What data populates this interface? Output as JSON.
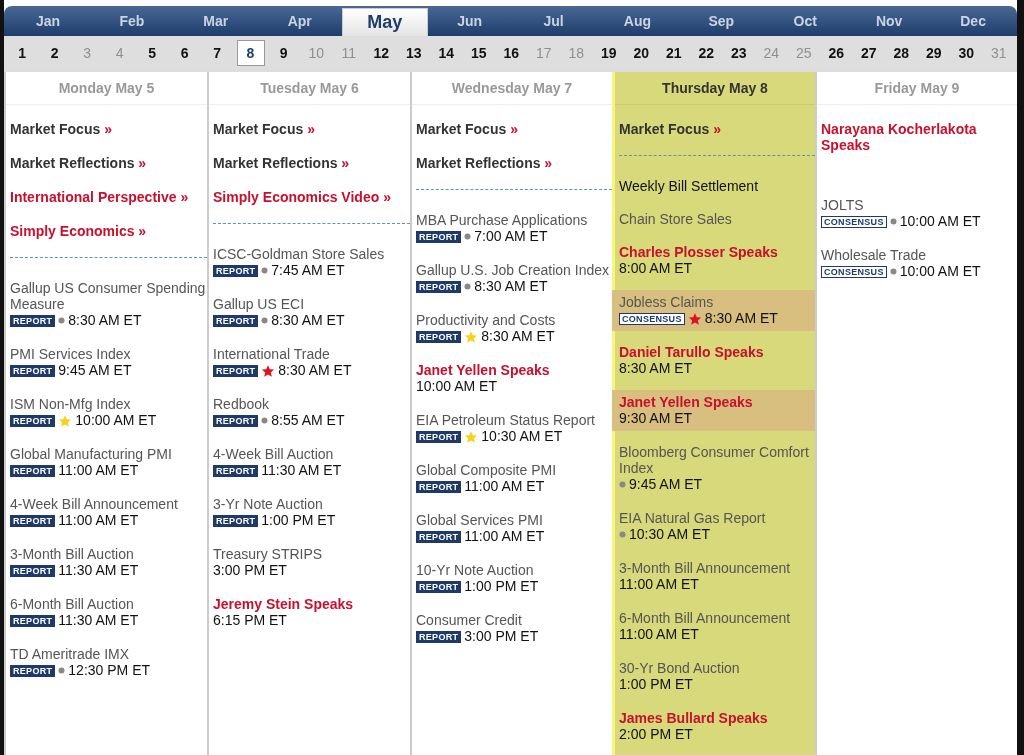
{
  "months": [
    {
      "label": "Jan",
      "selected": false
    },
    {
      "label": "Feb",
      "selected": false
    },
    {
      "label": "Mar",
      "selected": false
    },
    {
      "label": "Apr",
      "selected": false
    },
    {
      "label": "May",
      "selected": true
    },
    {
      "label": "Jun",
      "selected": false
    },
    {
      "label": "Jul",
      "selected": false
    },
    {
      "label": "Aug",
      "selected": false
    },
    {
      "label": "Sep",
      "selected": false
    },
    {
      "label": "Oct",
      "selected": false
    },
    {
      "label": "Nov",
      "selected": false
    },
    {
      "label": "Dec",
      "selected": false
    }
  ],
  "days": [
    {
      "label": "1",
      "selected": false,
      "weekend": false
    },
    {
      "label": "2",
      "selected": false,
      "weekend": false
    },
    {
      "label": "3",
      "selected": false,
      "weekend": true
    },
    {
      "label": "4",
      "selected": false,
      "weekend": true
    },
    {
      "label": "5",
      "selected": false,
      "weekend": false
    },
    {
      "label": "6",
      "selected": false,
      "weekend": false
    },
    {
      "label": "7",
      "selected": false,
      "weekend": false
    },
    {
      "label": "8",
      "selected": true,
      "weekend": false
    },
    {
      "label": "9",
      "selected": false,
      "weekend": false
    },
    {
      "label": "10",
      "selected": false,
      "weekend": true
    },
    {
      "label": "11",
      "selected": false,
      "weekend": true
    },
    {
      "label": "12",
      "selected": false,
      "weekend": false
    },
    {
      "label": "13",
      "selected": false,
      "weekend": false
    },
    {
      "label": "14",
      "selected": false,
      "weekend": false
    },
    {
      "label": "15",
      "selected": false,
      "weekend": false
    },
    {
      "label": "16",
      "selected": false,
      "weekend": false
    },
    {
      "label": "17",
      "selected": false,
      "weekend": true
    },
    {
      "label": "18",
      "selected": false,
      "weekend": true
    },
    {
      "label": "19",
      "selected": false,
      "weekend": false
    },
    {
      "label": "20",
      "selected": false,
      "weekend": false
    },
    {
      "label": "21",
      "selected": false,
      "weekend": false
    },
    {
      "label": "22",
      "selected": false,
      "weekend": false
    },
    {
      "label": "23",
      "selected": false,
      "weekend": false
    },
    {
      "label": "24",
      "selected": false,
      "weekend": true
    },
    {
      "label": "25",
      "selected": false,
      "weekend": true
    },
    {
      "label": "26",
      "selected": false,
      "weekend": false
    },
    {
      "label": "27",
      "selected": false,
      "weekend": false
    },
    {
      "label": "28",
      "selected": false,
      "weekend": false
    },
    {
      "label": "29",
      "selected": false,
      "weekend": false
    },
    {
      "label": "30",
      "selected": false,
      "weekend": false
    },
    {
      "label": "31",
      "selected": false,
      "weekend": true
    }
  ],
  "columns": [
    {
      "title": "Monday May 5",
      "today": false,
      "links": [
        {
          "label": "Market Focus",
          "arrow": "»",
          "kind": "feature"
        },
        {
          "label": "Market Reflections",
          "arrow": "»",
          "kind": "feature"
        },
        {
          "label": "International Perspective",
          "arrow": "»",
          "kind": "highlight"
        },
        {
          "label": "Simply Economics",
          "arrow": "»",
          "kind": "highlight"
        }
      ],
      "events": [
        {
          "name": "Gallup US Consumer Spending Measure",
          "kind": "release",
          "badge": "REPORT",
          "bullet": true,
          "starred": false,
          "time": "8:30 AM ET",
          "highlighted": false
        },
        {
          "name": "PMI Services Index",
          "kind": "release",
          "badge": "REPORT",
          "bullet": false,
          "starred": false,
          "time": "9:45 AM ET",
          "highlighted": false
        },
        {
          "name": "ISM Non-Mfg Index",
          "kind": "release",
          "badge": "REPORT",
          "bullet": false,
          "starred": true,
          "color": "#f7d21c",
          "time": "10:00 AM ET",
          "highlighted": false
        },
        {
          "name": "Global Manufacturing PMI",
          "kind": "release",
          "badge": "REPORT",
          "bullet": false,
          "starred": false,
          "time": "11:00 AM ET",
          "highlighted": false
        },
        {
          "name": "4-Week Bill Announcement",
          "kind": "release",
          "badge": "REPORT",
          "bullet": false,
          "starred": false,
          "time": "11:00 AM ET",
          "highlighted": false
        },
        {
          "name": "3-Month Bill Auction",
          "kind": "release",
          "badge": "REPORT",
          "bullet": false,
          "starred": false,
          "time": "11:30 AM ET",
          "highlighted": false
        },
        {
          "name": "6-Month Bill Auction",
          "kind": "release",
          "badge": "REPORT",
          "bullet": false,
          "starred": false,
          "time": "11:30 AM ET",
          "highlighted": false
        },
        {
          "name": "TD Ameritrade IMX",
          "kind": "release",
          "badge": "REPORT",
          "bullet": true,
          "starred": false,
          "time": "12:30 PM ET",
          "highlighted": false
        }
      ]
    },
    {
      "title": "Tuesday May 6",
      "today": false,
      "links": [
        {
          "label": "Market Focus",
          "arrow": "»",
          "kind": "feature"
        },
        {
          "label": "Market Reflections",
          "arrow": "»",
          "kind": "feature"
        },
        {
          "label": "Simply Economics Video",
          "arrow": "»",
          "kind": "highlight"
        }
      ],
      "events": [
        {
          "name": "ICSC-Goldman Store Sales",
          "kind": "release",
          "badge": "REPORT",
          "bullet": true,
          "starred": false,
          "time": "7:45 AM ET",
          "highlighted": false
        },
        {
          "name": "Gallup US ECI",
          "kind": "release",
          "badge": "REPORT",
          "bullet": true,
          "starred": false,
          "time": "8:30 AM ET",
          "highlighted": false
        },
        {
          "name": "International Trade",
          "kind": "release",
          "badge": "REPORT",
          "bullet": false,
          "starred": true,
          "color": "#e01020",
          "time": "8:30 AM ET",
          "highlighted": false
        },
        {
          "name": "Redbook",
          "kind": "release",
          "badge": "REPORT",
          "bullet": true,
          "starred": false,
          "time": "8:55 AM ET",
          "highlighted": false
        },
        {
          "name": "4-Week Bill Auction",
          "kind": "release",
          "badge": "REPORT",
          "bullet": false,
          "starred": false,
          "time": "11:30 AM ET",
          "highlighted": false
        },
        {
          "name": "3-Yr Note Auction",
          "kind": "release",
          "badge": "REPORT",
          "bullet": false,
          "starred": false,
          "time": "1:00 PM ET",
          "highlighted": false
        },
        {
          "name": "Treasury STRIPS",
          "kind": "release",
          "bullet": false,
          "starred": false,
          "time": "3:00 PM ET",
          "highlighted": false
        },
        {
          "name": "Jeremy Stein Speaks",
          "kind": "speech",
          "bullet": false,
          "starred": false,
          "time": "6:15 PM ET",
          "highlighted": false
        }
      ]
    },
    {
      "title": "Wednesday May 7",
      "today": false,
      "links": [
        {
          "label": "Market Focus",
          "arrow": "»",
          "kind": "feature"
        },
        {
          "label": "Market Reflections",
          "arrow": "»",
          "kind": "feature"
        }
      ],
      "events": [
        {
          "name": "MBA Purchase Applications",
          "kind": "release",
          "badge": "REPORT",
          "bullet": true,
          "starred": false,
          "time": "7:00 AM ET",
          "highlighted": false
        },
        {
          "name": "Gallup U.S. Job Creation Index",
          "kind": "release",
          "badge": "REPORT",
          "bullet": true,
          "starred": false,
          "time": "8:30 AM ET",
          "highlighted": false
        },
        {
          "name": "Productivity and Costs",
          "kind": "release",
          "badge": "REPORT",
          "bullet": false,
          "starred": true,
          "color": "#f7d21c",
          "time": "8:30 AM ET",
          "highlighted": false
        },
        {
          "name": "Janet Yellen Speaks",
          "kind": "speech",
          "bullet": false,
          "starred": false,
          "time": "10:00 AM ET",
          "highlighted": false
        },
        {
          "name": "EIA Petroleum Status Report",
          "kind": "release",
          "badge": "REPORT",
          "bullet": false,
          "starred": true,
          "color": "#f7d21c",
          "time": "10:30 AM ET",
          "highlighted": false
        },
        {
          "name": "Global Composite PMI",
          "kind": "release",
          "badge": "REPORT",
          "bullet": false,
          "starred": false,
          "time": "11:00 AM ET",
          "highlighted": false
        },
        {
          "name": "Global Services PMI",
          "kind": "release",
          "badge": "REPORT",
          "bullet": false,
          "starred": false,
          "time": "11:00 AM ET",
          "highlighted": false
        },
        {
          "name": "10-Yr Note Auction",
          "kind": "release",
          "badge": "REPORT",
          "bullet": false,
          "starred": false,
          "time": "1:00 PM ET",
          "highlighted": false
        },
        {
          "name": "Consumer Credit",
          "kind": "release",
          "badge": "REPORT",
          "bullet": false,
          "starred": false,
          "time": "3:00 PM ET",
          "highlighted": false
        }
      ]
    },
    {
      "title": "Thursday May 8",
      "today": true,
      "links": [
        {
          "label": "Market Focus",
          "arrow": "»",
          "kind": "feature"
        }
      ],
      "events": [
        {
          "name": "Weekly Bill Settlement",
          "kind": "notice",
          "bullet": false,
          "starred": false,
          "highlighted": false
        },
        {
          "name": "Chain Store Sales",
          "kind": "release",
          "bullet": false,
          "starred": false,
          "highlighted": false
        },
        {
          "name": "Charles Plosser Speaks",
          "kind": "speech",
          "bullet": false,
          "starred": false,
          "time": "8:00 AM ET",
          "highlighted": false
        },
        {
          "name": "Jobless Claims",
          "kind": "release",
          "badge": "CONSENSUS",
          "bullet": false,
          "starred": true,
          "color": "#e01020",
          "time": "8:30 AM ET",
          "highlighted": true
        },
        {
          "name": "Daniel Tarullo Speaks",
          "kind": "speech",
          "bullet": false,
          "starred": false,
          "time": "8:30 AM ET",
          "highlighted": false
        },
        {
          "name": "Janet Yellen Speaks",
          "kind": "speech",
          "bullet": false,
          "starred": false,
          "time": "9:30 AM ET",
          "highlighted": true
        },
        {
          "name": "Bloomberg Consumer Comfort Index",
          "kind": "release",
          "bullet": true,
          "starred": false,
          "time": "9:45 AM ET",
          "highlighted": false
        },
        {
          "name": "EIA Natural Gas Report",
          "kind": "release",
          "bullet": true,
          "starred": false,
          "time": "10:30 AM ET",
          "highlighted": false
        },
        {
          "name": "3-Month Bill Announcement",
          "kind": "release",
          "bullet": false,
          "starred": false,
          "time": "11:00 AM ET",
          "highlighted": false
        },
        {
          "name": "6-Month Bill Announcement",
          "kind": "release",
          "bullet": false,
          "starred": false,
          "time": "11:00 AM ET",
          "highlighted": false
        },
        {
          "name": "30-Yr Bond Auction",
          "kind": "release",
          "bullet": false,
          "starred": false,
          "time": "1:00 PM ET",
          "highlighted": false
        },
        {
          "name": "James Bullard Speaks",
          "kind": "speech",
          "bullet": false,
          "starred": false,
          "time": "2:00 PM ET",
          "highlighted": false
        }
      ]
    },
    {
      "title": "Friday May 9",
      "today": false,
      "links": [
        {
          "label": "Narayana Kocherlakota Speaks",
          "kind": "highlight"
        }
      ],
      "events": [
        {
          "name": "JOLTS",
          "kind": "release",
          "badge": "CONSENSUS",
          "bullet": true,
          "starred": false,
          "time": "10:00 AM ET",
          "highlighted": false
        },
        {
          "name": "Wholesale Trade",
          "kind": "release",
          "badge": "CONSENSUS",
          "bullet": true,
          "starred": false,
          "time": "10:00 AM ET",
          "highlighted": false
        }
      ]
    }
  ]
}
